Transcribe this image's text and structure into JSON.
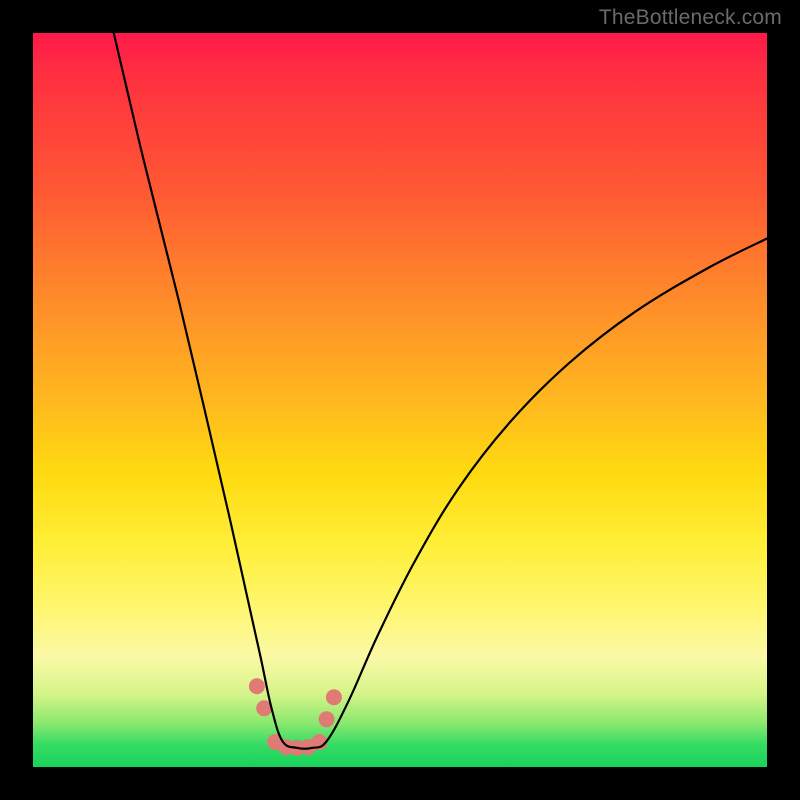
{
  "watermark": "TheBottleneck.com",
  "chart_data": {
    "type": "line",
    "title": "",
    "xlabel": "",
    "ylabel": "",
    "xlim": [
      0,
      100
    ],
    "ylim": [
      0,
      100
    ],
    "grid": false,
    "series": [
      {
        "name": "bottleneck-curve",
        "x": [
          11,
          15,
          20,
          24,
          27,
          29,
          31,
          32.5,
          34,
          36,
          38,
          40,
          43,
          47,
          52,
          58,
          65,
          73,
          82,
          92,
          100
        ],
        "values": [
          100,
          83,
          63,
          46,
          33,
          24,
          15,
          8,
          3.5,
          2.6,
          2.6,
          3.5,
          9,
          18,
          28,
          38,
          47,
          55,
          62,
          68,
          72
        ]
      }
    ],
    "markers": {
      "name": "highlight-dots",
      "x": [
        30.5,
        31.5,
        33.0,
        34.5,
        36.0,
        37.5,
        39.0,
        40.0,
        41.0
      ],
      "values": [
        11.0,
        8.0,
        3.4,
        2.7,
        2.6,
        2.7,
        3.4,
        6.5,
        9.5
      ],
      "color": "#e07a74",
      "radius": 8
    }
  }
}
